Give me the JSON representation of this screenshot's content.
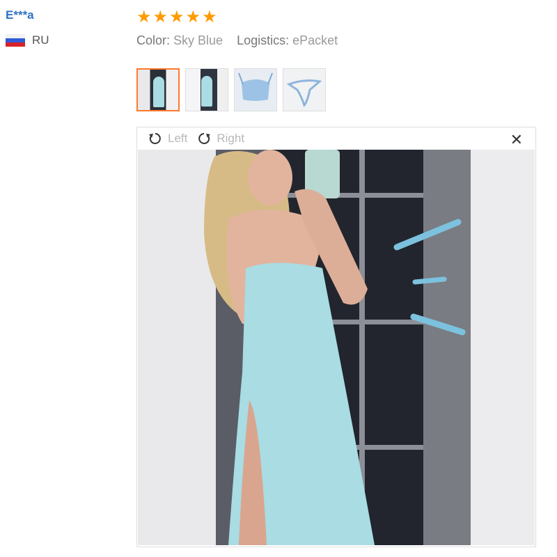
{
  "reviewer": {
    "name": "E***a",
    "country": "RU",
    "flag_icon": "russia-flag-icon"
  },
  "rating": {
    "stars": 5,
    "max": 5,
    "color": "#ff9a00"
  },
  "meta": {
    "color_label": "Color:",
    "color_value": "Sky Blue",
    "logistics_label": "Logistics:",
    "logistics_value": "ePacket"
  },
  "thumbnails": [
    {
      "alt": "dress-photo-1",
      "active": true
    },
    {
      "alt": "dress-photo-2",
      "active": false
    },
    {
      "alt": "bra-photo",
      "active": false
    },
    {
      "alt": "panty-photo",
      "active": false
    }
  ],
  "viewer": {
    "rotate_left_label": "Left",
    "rotate_right_label": "Right",
    "close_glyph": "✕"
  },
  "colors": {
    "accent": "#ff7a2b",
    "username": "#2a72c4",
    "dress": "#a9dce3"
  }
}
